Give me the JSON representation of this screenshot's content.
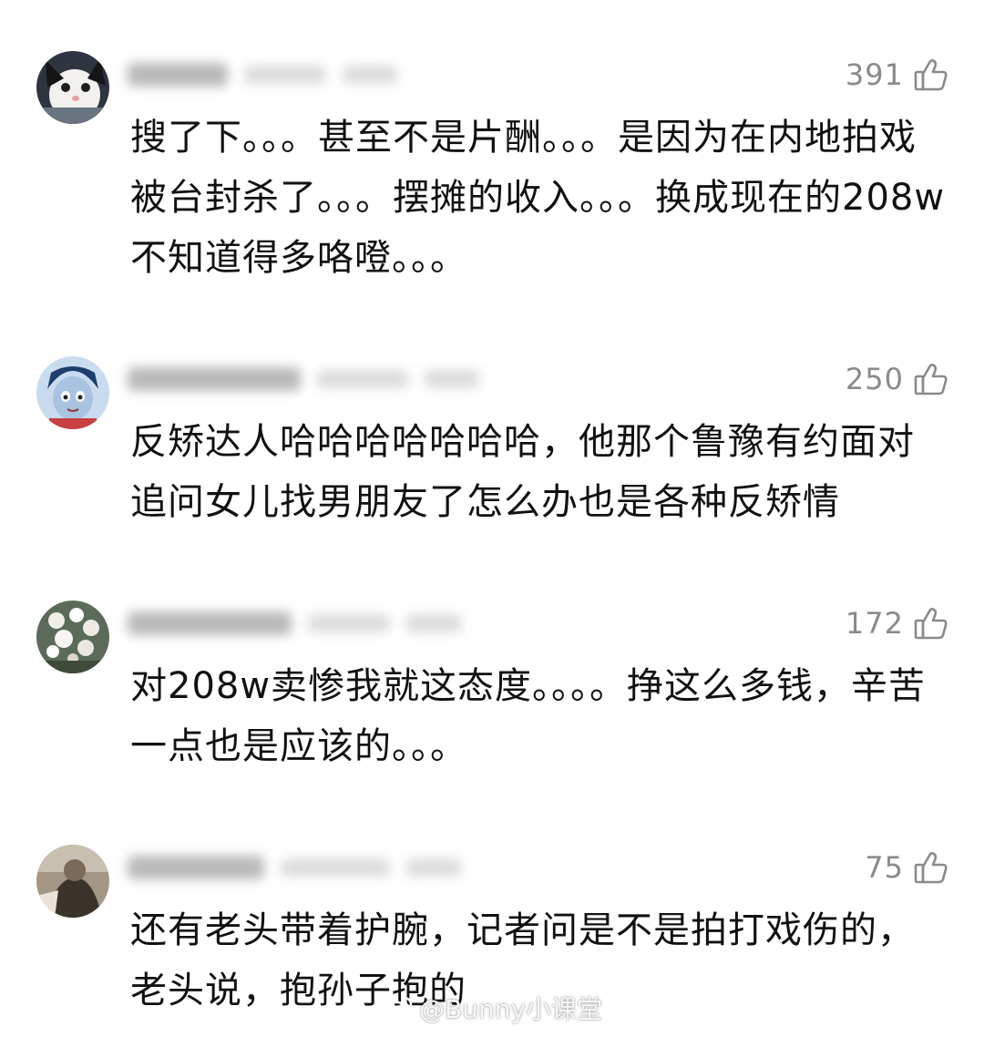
{
  "comments": [
    {
      "likes": "391",
      "text": "搜了下。。。甚至不是片酬。。。是因为在内地拍戏被台封杀了。。。摆摊的收入。。。换成现在的208w不知道得多咯噔。。。",
      "avatar_icon": "cat-avatar-icon"
    },
    {
      "likes": "250",
      "text": "反矫达人哈哈哈哈哈哈哈，他那个鲁豫有约面对追问女儿找男朋友了怎么办也是各种反矫情",
      "avatar_icon": "cartoon-avatar-icon"
    },
    {
      "likes": "172",
      "text": "对208w卖惨我就这态度。。。。挣这么多钱，辛苦一点也是应该的。。。",
      "avatar_icon": "flowers-avatar-icon"
    },
    {
      "likes": "75",
      "text": "还有老头带着护腕，记者问是不是拍打戏伤的，老头说，抱孙子抱的",
      "avatar_icon": "photo-avatar-icon"
    }
  ],
  "watermark": {
    "text": "@Bunny小课堂"
  },
  "colors": {
    "text": "#111111",
    "meta": "#8a8a8a",
    "background": "#ffffff"
  }
}
